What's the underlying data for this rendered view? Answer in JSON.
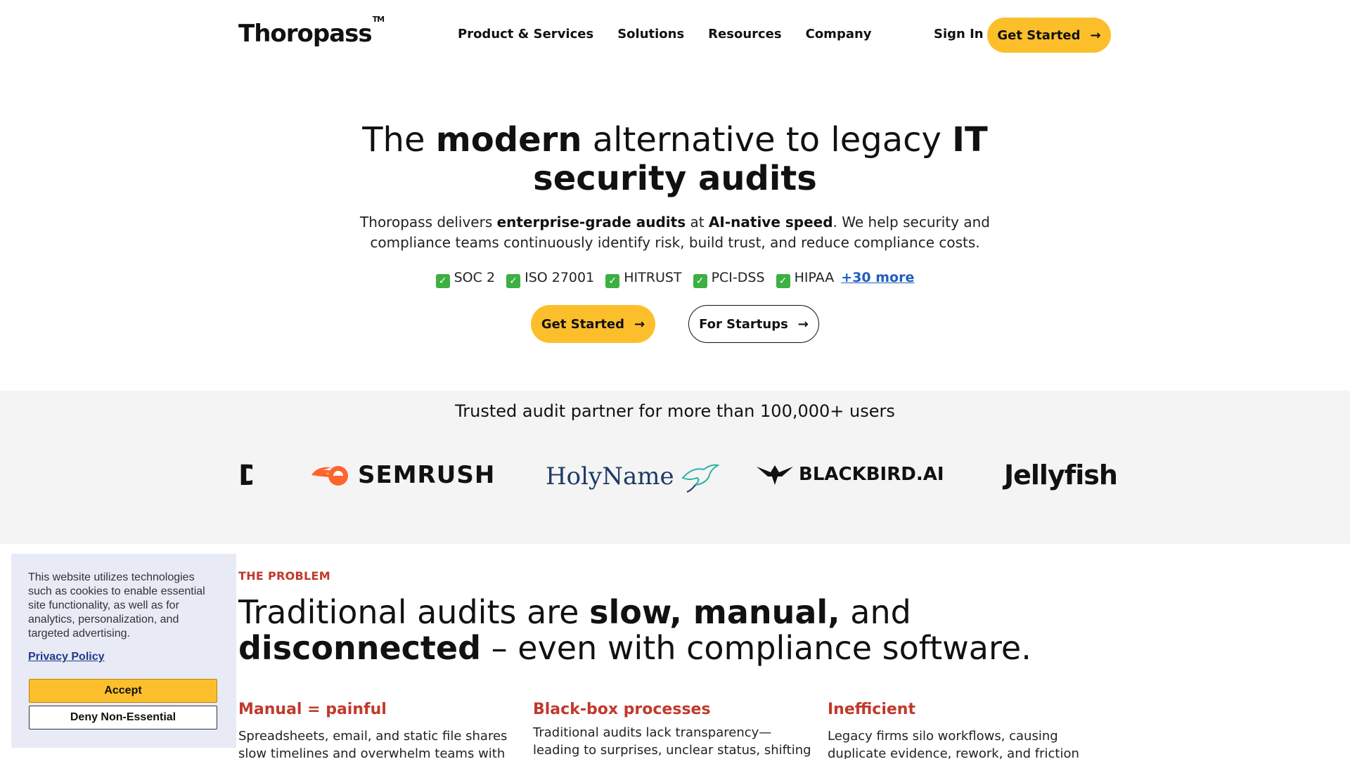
{
  "header": {
    "logo": "Thoropass",
    "logo_tm": "TM",
    "nav": [
      "Product & Services",
      "Solutions",
      "Resources",
      "Company"
    ],
    "signin": "Sign In",
    "cta": "Get Started"
  },
  "hero": {
    "title_1": "The ",
    "title_2": "modern",
    "title_3": " alternative to legacy ",
    "title_4": "IT security audits",
    "sub_1": "Thoropass delivers ",
    "sub_2": "enterprise-grade audits",
    "sub_3": " at ",
    "sub_4": "AI-native speed",
    "sub_5": ". We help security and compliance teams continuously identify risk, build trust, and reduce compliance costs.",
    "frameworks": [
      "SOC 2",
      "ISO 27001",
      "HITRUST",
      "PCI-DSS",
      "HIPAA"
    ],
    "more": "+30 more",
    "cta_primary": "Get Started",
    "cta_secondary": "For Startups"
  },
  "trusted": {
    "title": "Trusted audit partner for more than 100,000+ users",
    "logos": [
      "SEMRUSH",
      "HolyName",
      "BLACKBIRD.AI",
      "Jellyfish"
    ]
  },
  "problem": {
    "eyebrow": "THE PROBLEM",
    "title_1": "Traditional audits are ",
    "title_2": "slow, manual,",
    "title_3": " and ",
    "title_4": "disconnected",
    "title_5": " – even with compliance software.",
    "columns": [
      {
        "heading": "Manual = painful",
        "text": "Spreadsheets, email, and static file shares slow timelines and overwhelm teams with audit"
      },
      {
        "heading": "Black-box processes",
        "text": "Traditional audits lack transparency—leading to surprises, unclear status, shifting"
      },
      {
        "heading": "Inefficient",
        "text": "Legacy firms silo workflows, causing duplicate evidence, rework, and friction from separate"
      }
    ]
  },
  "cookie": {
    "text": "This website utilizes technologies such as cookies to enable essential site functionality, as well as for analytics, personalization, and targeted advertising.",
    "policy": "Privacy Policy",
    "accept": "Accept",
    "deny": "Deny Non-Essential"
  },
  "colors": {
    "accent": "#fcbf2b",
    "problem_red": "#c0392b",
    "link_blue": "#1f5fbf",
    "cookie_bg": "#e8eaf6",
    "band_bg": "#f4f4f4"
  }
}
